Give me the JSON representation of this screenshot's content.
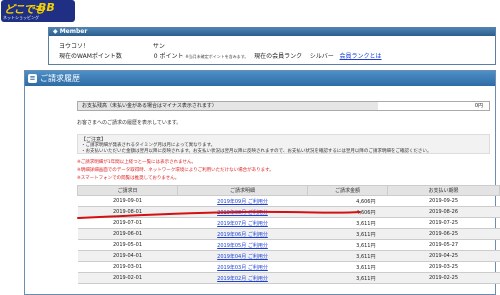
{
  "logo": {
    "brand_a": "どこでも",
    "brand_b": "BB",
    "tagline": "ネットショッピング",
    "corner": ""
  },
  "member": {
    "title": "Member",
    "greeting_label": "ヨウコソ！",
    "greeting_suffix": "サン",
    "points_label": "現在のWAMポイント数",
    "points_value": "0",
    "points_unit": "ポイント",
    "points_note": "※当月未確定ポイントを含みます。",
    "rank_label": "現在の会員ランク",
    "rank_value": "シルバー",
    "rank_link": "会員ランクとは"
  },
  "panel": {
    "title": "ご請求履歴",
    "balance_label": "お支払残高（未払い金がある場合はマイナス表示されます）",
    "balance_value": "0円",
    "intro": "お客さまへのご請求の履歴を表示しています。",
    "notes_title": "【ご注意】",
    "note1": "・ご請求明細が発表されるタイミング月は月によって異なります。",
    "note2": "・お支払いいただいた金額は翌月以降に反映されます。お支払い状況は翌月以降に反映されますので、お支払い状況を確認するには翌月以降のご請求明細をご確認ください。",
    "red1": "※ご請求明細が1年間以上経つと一覧には表示されません。",
    "red2": "※明細詳細画面でのデータ取得時、ネットワーク環境によりご利用いただけない場合があります。",
    "red3": "※スマートフォンでの閲覧は推奨しておりません。"
  },
  "table": {
    "headers": [
      "ご請求日",
      "ご請求明細",
      "ご請求金額",
      "お支払い期限"
    ],
    "rows": [
      {
        "date": "2019-09-01",
        "link": "2019年09月 ご利用分",
        "amount": "4,606円",
        "due": "2019-09-25"
      },
      {
        "date": "2019-08-01",
        "link": "2019年08月 ご利用分",
        "amount": "4,606円",
        "due": "2019-08-26"
      },
      {
        "date": "2019-07-01",
        "link": "2019年07月 ご利用分",
        "amount": "3,611円",
        "due": "2019-07-25"
      },
      {
        "date": "2019-06-01",
        "link": "2019年06月 ご利用分",
        "amount": "3,611円",
        "due": "2019-06-25"
      },
      {
        "date": "2019-05-01",
        "link": "2019年05月 ご利用分",
        "amount": "3,611円",
        "due": "2019-05-27"
      },
      {
        "date": "2019-04-01",
        "link": "2019年04月 ご利用分",
        "amount": "3,611円",
        "due": "2019-04-25"
      },
      {
        "date": "2019-03-01",
        "link": "2019年03月 ご利用分",
        "amount": "3,611円",
        "due": "2019-03-25"
      },
      {
        "date": "2019-02-01",
        "link": "2019年02月 ご利用分",
        "amount": "3,611円",
        "due": "2019-02-25"
      }
    ]
  },
  "colors": {
    "header_blue": "#2d6ba4",
    "link_blue": "#1a3fd8",
    "annotation_red": "#d41010",
    "logo_yellow": "#f4d000"
  }
}
